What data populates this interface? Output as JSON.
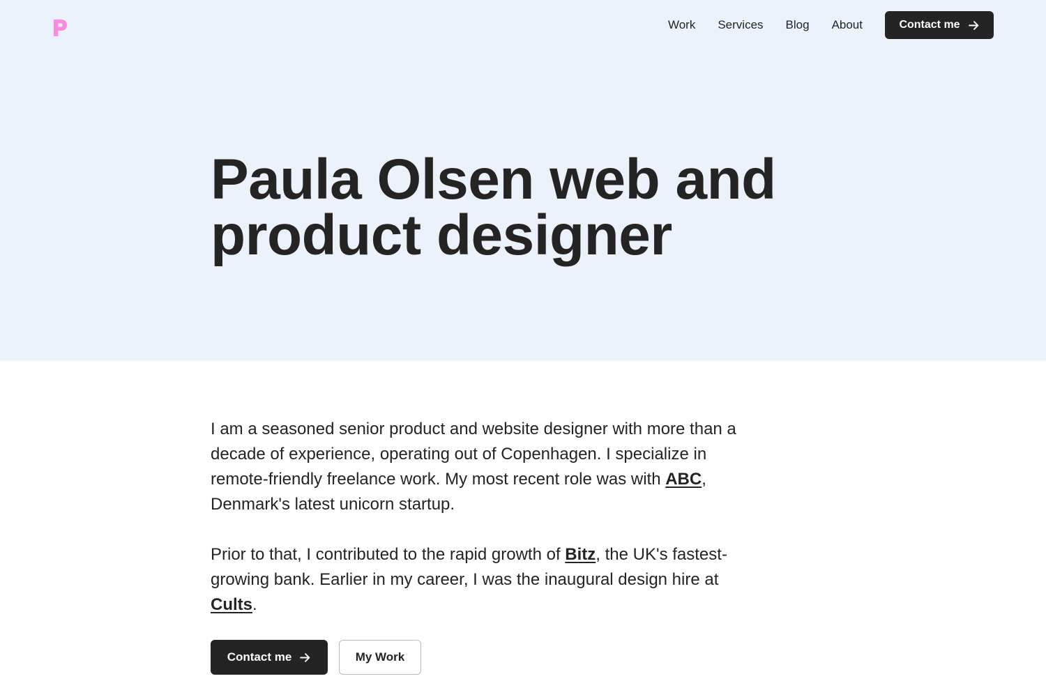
{
  "brand": {
    "logo_letter": "P",
    "logo_color": "#f98be0"
  },
  "nav": {
    "links": [
      "Work",
      "Services",
      "Blog",
      "About"
    ],
    "cta_label": "Contact me"
  },
  "hero": {
    "title": "Paula Olsen web and product designer",
    "background": "#ebf2fb"
  },
  "intro": {
    "p1_before": "I am a seasoned senior product and website designer with more than a decade of experience, operating out of Copenhagen. I specialize in remote-friendly freelance work. My most recent role was with ",
    "p1_link": "ABC",
    "p1_after": ", Denmark's latest unicorn startup.",
    "p2_before": "Prior to that, I contributed to the rapid growth of ",
    "p2_link1": "Bitz",
    "p2_middle": ", the UK's fastest-growing bank. Earlier in my career, I was the inaugural design hire at ",
    "p2_link2": "Cults",
    "p2_after": "."
  },
  "actions": {
    "contact_label": "Contact me",
    "work_label": "My Work"
  },
  "colors": {
    "text": "#242424",
    "button_dark": "#242424"
  }
}
